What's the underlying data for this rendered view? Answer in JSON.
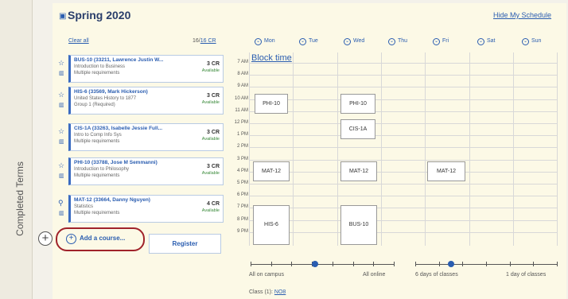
{
  "sidebar": {
    "label": "Completed Terms"
  },
  "header": {
    "title": "Spring 2020",
    "hide_link": "Hide My Schedule"
  },
  "list": {
    "clear_all": "Clear all",
    "credits_current": "16",
    "credits_total": "16 CR"
  },
  "courses": [
    {
      "title": "BUS-10 (33211, Lawrence Justin W...",
      "subtitle": "Introduction to Business",
      "req": "Multiple requirements",
      "credits": "3 CR",
      "status": "Available"
    },
    {
      "title": "HIS-6 (33569, Mark Hickerson)",
      "subtitle": "United States History to 1877",
      "req": "Group 1 (Required)",
      "credits": "3 CR",
      "status": "Available"
    },
    {
      "title": "CIS-1A (33263, Isabelle Jessie Full...",
      "subtitle": "Intro to Comp Info Sys",
      "req": "Multiple requirements",
      "credits": "3 CR",
      "status": "Available"
    },
    {
      "title": "PHI-10 (33788, Jose M Semmanni)",
      "subtitle": "Introduction to Philosophy",
      "req": "Multiple requirements",
      "credits": "3 CR",
      "status": "Available"
    },
    {
      "title": "MAT-12 (33664, Danny Nguyen)",
      "subtitle": "Statistics",
      "req": "Multiple requirements",
      "credits": "4 CR",
      "status": "Available"
    }
  ],
  "actions": {
    "add_course": "Add a course...",
    "register": "Register"
  },
  "days": [
    "Mon",
    "Tue",
    "Wed",
    "Thu",
    "Fri",
    "Sat",
    "Sun"
  ],
  "block_time": "Block time",
  "times": [
    "7 AM",
    "8 AM",
    "9 AM",
    "10 AM",
    "11 AM",
    "12 PM",
    "1 PM",
    "2 PM",
    "3 PM",
    "4 PM",
    "5 PM",
    "6 PM",
    "7 PM",
    "8 PM",
    "9 PM"
  ],
  "events": {
    "phi_mon": "PHI-10",
    "phi_wed": "PHI-10",
    "cis_wed": "CIS-1A",
    "mat_mon": "MAT-12",
    "mat_wed": "MAT-12",
    "mat_fri": "MAT-12",
    "his_mon": "HIS-6",
    "bus_wed": "BUS-10"
  },
  "sliders": {
    "location": {
      "left_label": "All on campus",
      "right_label": "All online",
      "value": 0.45
    },
    "days": {
      "left_label": "6 days of classes",
      "right_label": "1 day of classes",
      "value": 0.25
    }
  },
  "footer": {
    "class_text": "Class (1):",
    "class_link": "NO8"
  },
  "colors": {
    "accent": "#2a5db0",
    "highlight_ring": "#a0222a"
  }
}
